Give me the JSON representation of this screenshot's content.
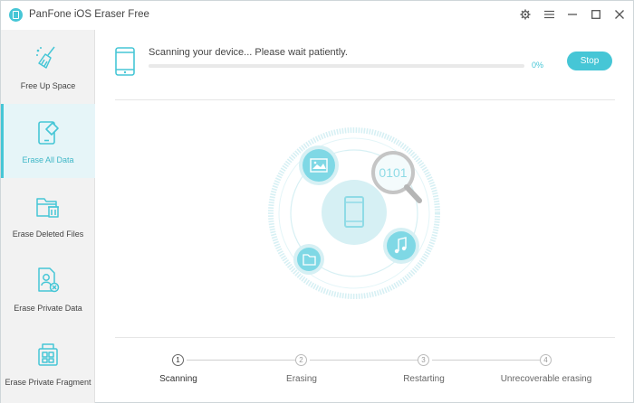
{
  "window": {
    "title": "PanFone iOS Eraser Free"
  },
  "sidebar": {
    "items": [
      {
        "label": "Free Up Space",
        "icon": "broom-icon"
      },
      {
        "label": "Erase All Data",
        "icon": "phone-eraser-icon",
        "active": true
      },
      {
        "label": "Erase Deleted Files",
        "icon": "folder-trash-icon"
      },
      {
        "label": "Erase Private Data",
        "icon": "private-document-icon"
      },
      {
        "label": "Erase Private Fragment",
        "icon": "fragment-icon"
      }
    ]
  },
  "scan": {
    "status_text": "Scanning your device... Please wait patiently.",
    "progress_text": "0%",
    "progress": 0,
    "stop_label": "Stop"
  },
  "illustration": {
    "binary_text": "0101"
  },
  "steps": [
    {
      "number": "1",
      "label": "Scanning"
    },
    {
      "number": "2",
      "label": "Erasing"
    },
    {
      "number": "3",
      "label": "Restarting"
    },
    {
      "number": "4",
      "label": "Unrecoverable erasing"
    }
  ],
  "colors": {
    "accent": "#46c6d6",
    "sidebar_bg": "#f2f2f2",
    "active_bg": "#e6f5f8"
  }
}
